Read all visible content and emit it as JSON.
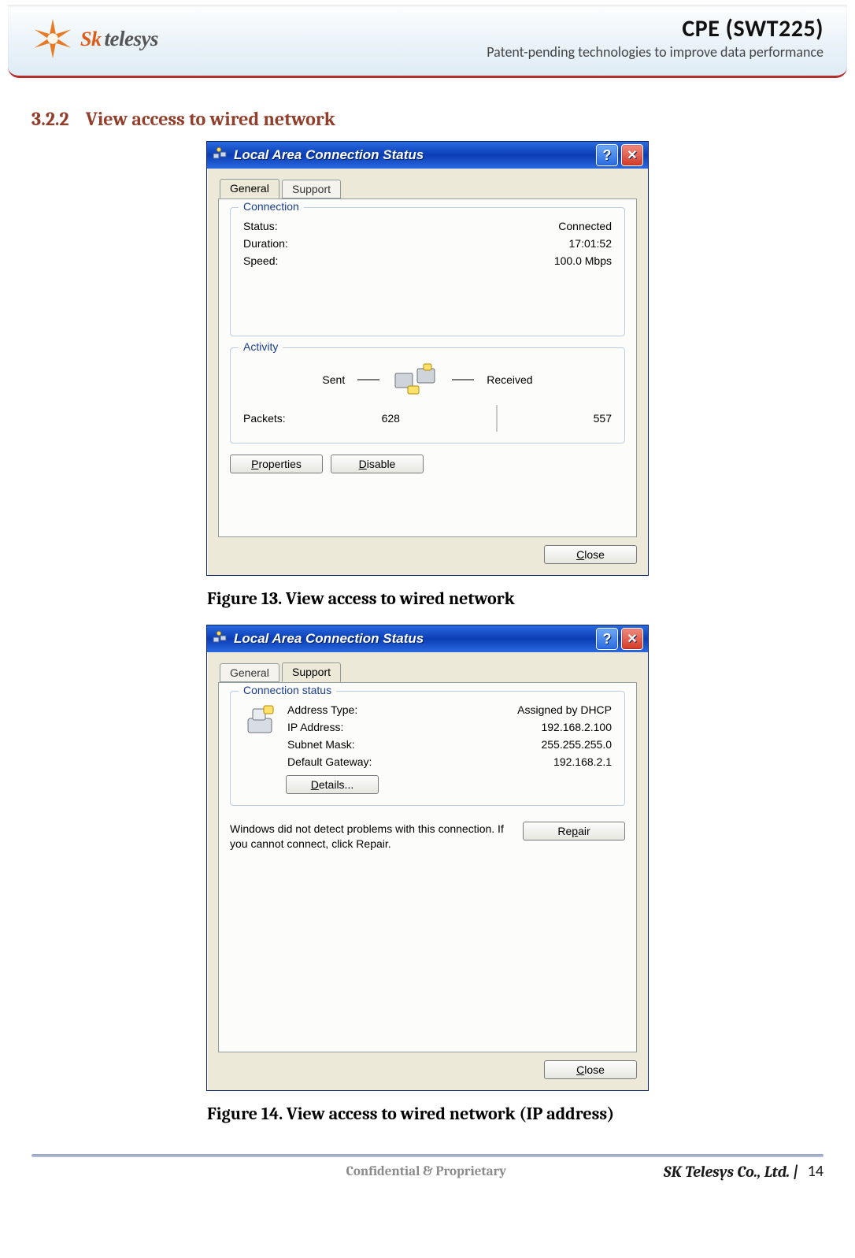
{
  "header": {
    "logo_brand_sk": "Sk",
    "logo_brand_telesys": "telesys",
    "title": "CPE (SWT225)",
    "subtitle": "Patent-pending technologies to improve data performance"
  },
  "section": {
    "number": "3.2.2",
    "title": "View access to wired network"
  },
  "fig13": {
    "window_title": "Local Area Connection Status",
    "tab_general": "General",
    "tab_support": "Support",
    "group_connection": "Connection",
    "status_label": "Status:",
    "status_value": "Connected",
    "duration_label": "Duration:",
    "duration_value": "17:01:52",
    "speed_label": "Speed:",
    "speed_value": "100.0 Mbps",
    "group_activity": "Activity",
    "sent_label": "Sent",
    "received_label": "Received",
    "packets_label": "Packets:",
    "packets_sent": "628",
    "packets_received": "557",
    "btn_properties": "Properties",
    "btn_disable": "Disable",
    "btn_close": "Close",
    "caption": "Figure 13. View access to wired network"
  },
  "fig14": {
    "window_title": "Local Area Connection Status",
    "tab_general": "General",
    "tab_support": "Support",
    "group_status": "Connection status",
    "addr_type_label": "Address Type:",
    "addr_type_value": "Assigned by DHCP",
    "ip_label": "IP Address:",
    "ip_value": "192.168.2.100",
    "mask_label": "Subnet Mask:",
    "mask_value": "255.255.255.0",
    "gw_label": "Default Gateway:",
    "gw_value": "192.168.2.1",
    "btn_details": "Details...",
    "note_text": "Windows did not detect problems with this connection. If you cannot connect, click Repair.",
    "btn_repair": "Repair",
    "btn_close": "Close",
    "caption": "Figure 14. View access to wired network (IP address)"
  },
  "footer": {
    "confidential": "Confidential & Proprietary",
    "company": "SK Telesys Co., Ltd. |",
    "page": "14"
  }
}
